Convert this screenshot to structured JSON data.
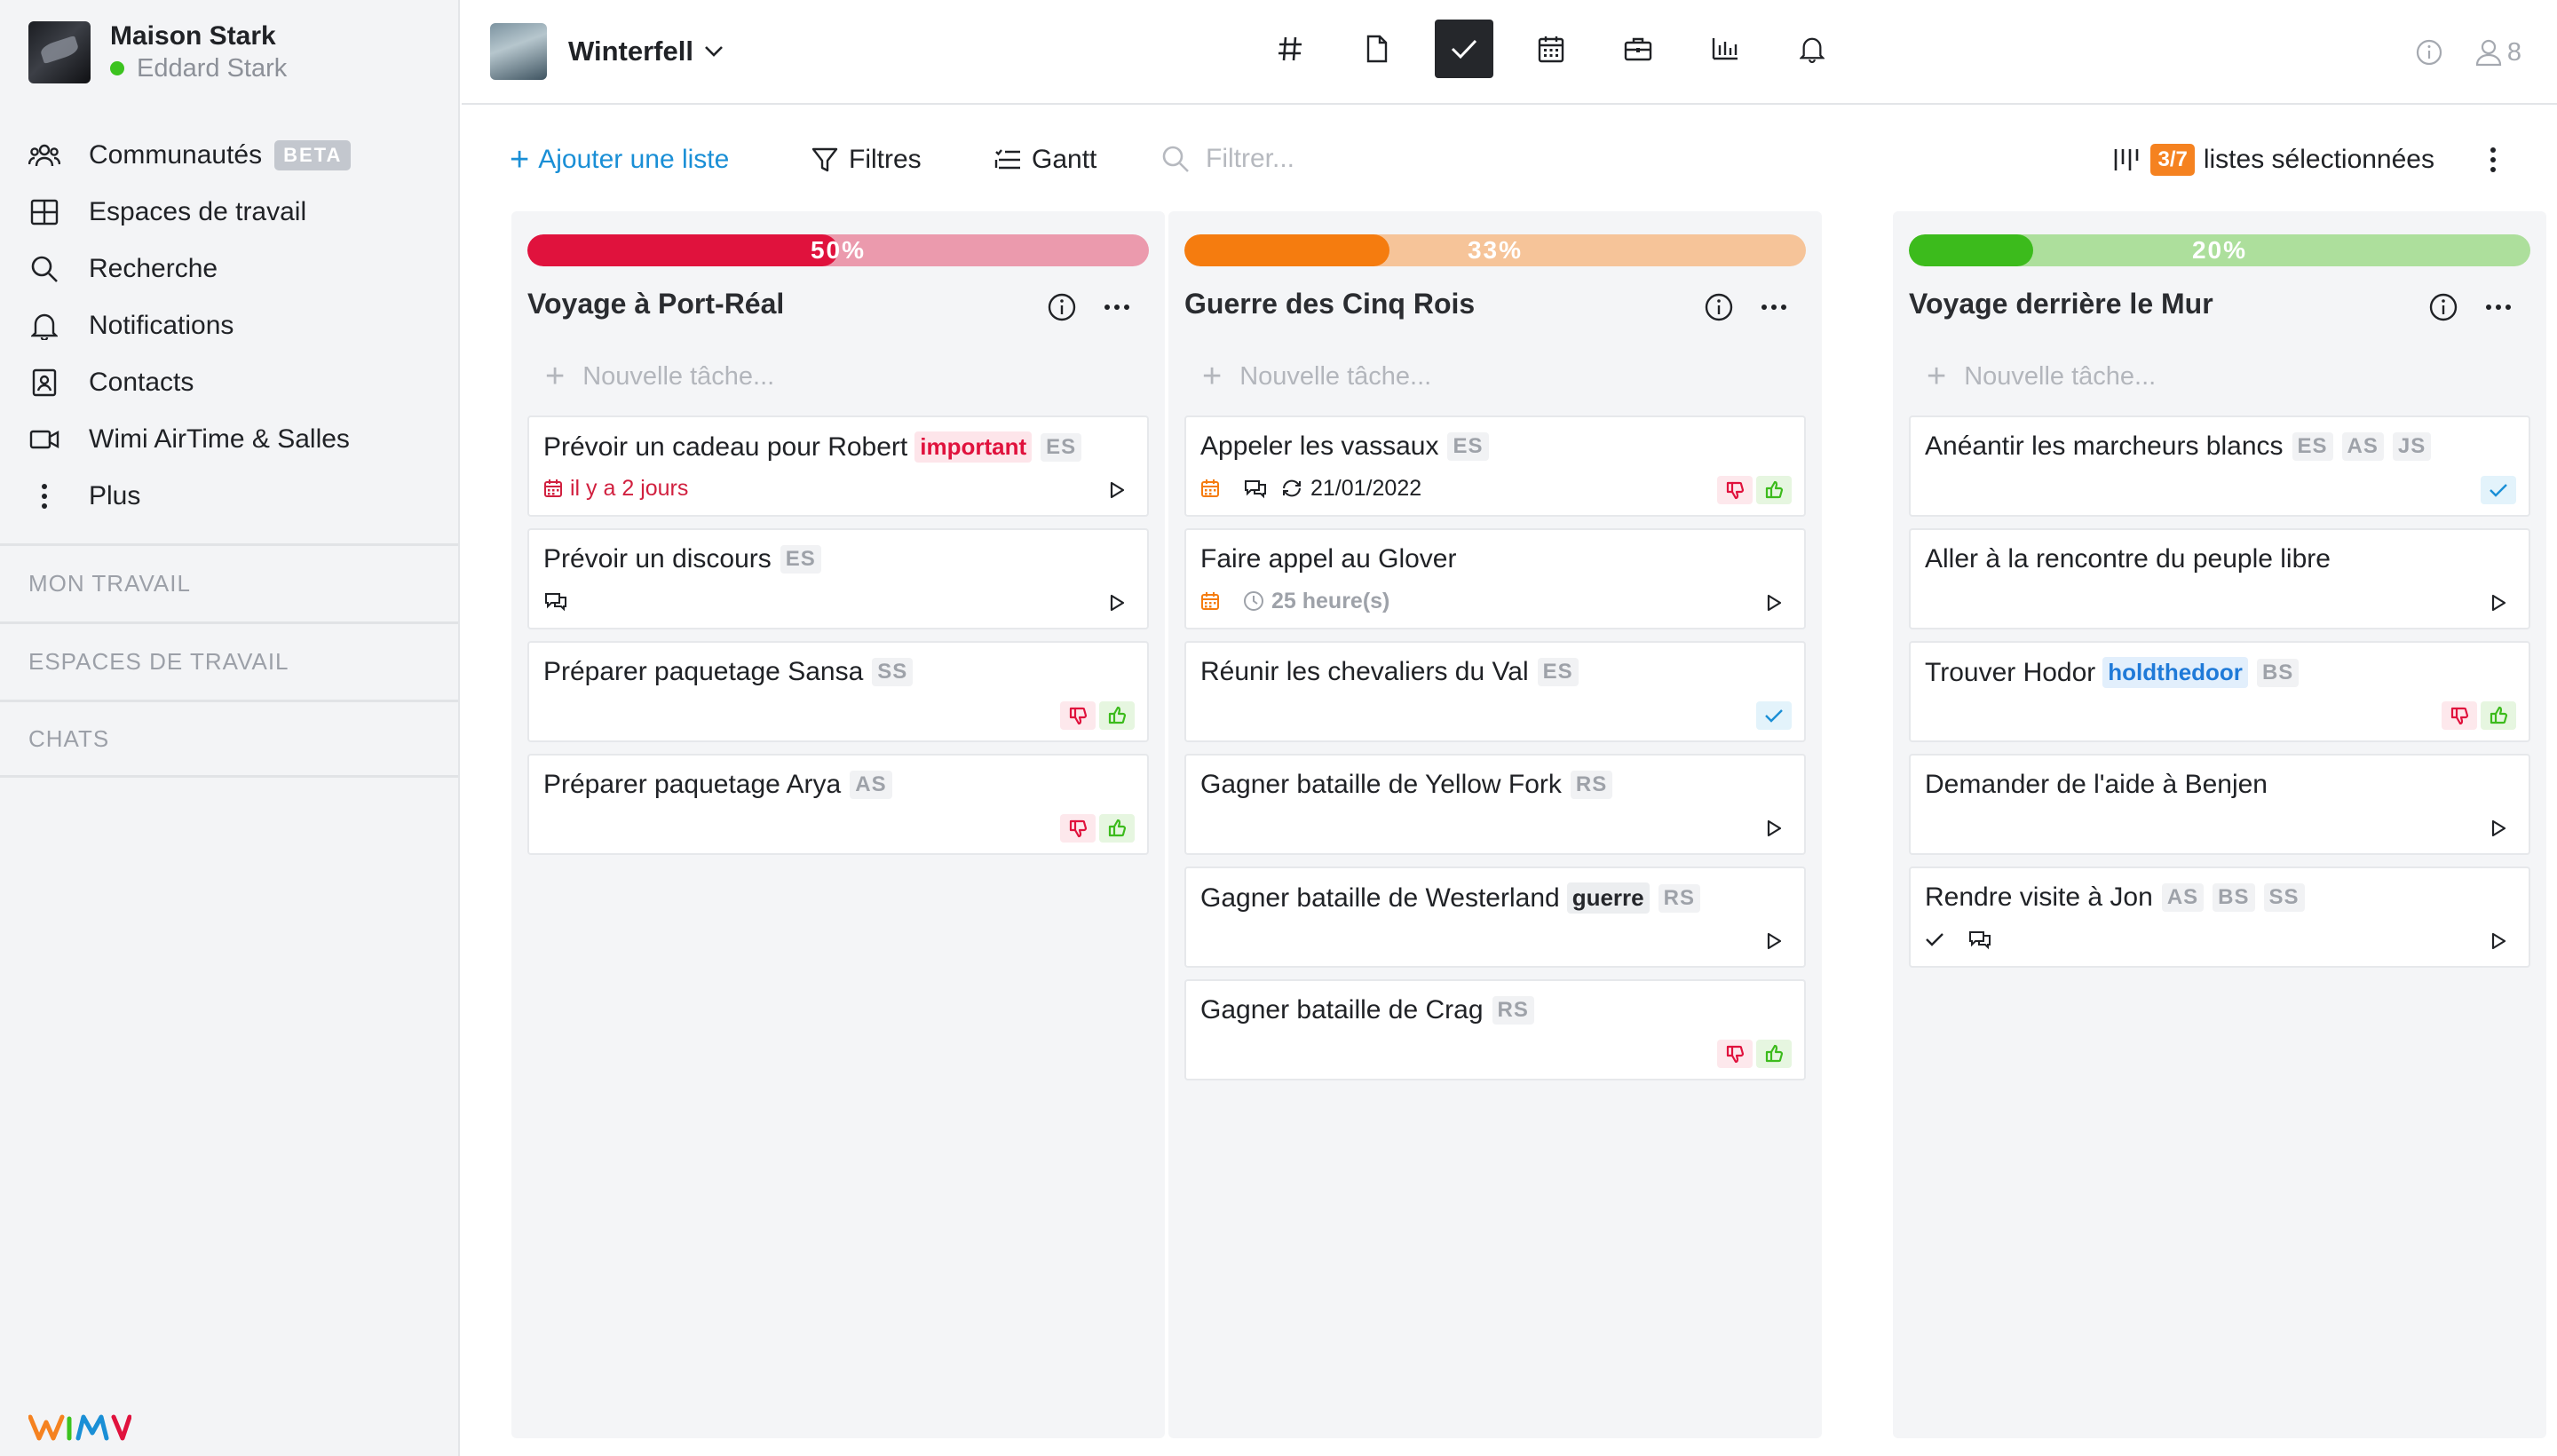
{
  "account": {
    "org": "Maison Stark",
    "user": "Eddard Stark"
  },
  "nav": {
    "items": [
      {
        "label": "Communautés",
        "badge": "BETA"
      },
      {
        "label": "Espaces de travail"
      },
      {
        "label": "Recherche"
      },
      {
        "label": "Notifications"
      },
      {
        "label": "Contacts"
      },
      {
        "label": "Wimi AirTime & Salles"
      },
      {
        "label": "Plus"
      }
    ]
  },
  "sections": [
    "MON TRAVAIL",
    "ESPACES DE TRAVAIL",
    "CHATS"
  ],
  "workspace": {
    "name": "Winterfell"
  },
  "topbar": {
    "member_count": "8"
  },
  "toolbar": {
    "add_list": "Ajouter une liste",
    "filters": "Filtres",
    "gantt": "Gantt",
    "search_placeholder": "Filtrer...",
    "selected_badge": "3/7",
    "selected_label": "listes sélectionnées"
  },
  "colors": {
    "accent": "#1a8fd6",
    "red": "#e0123d",
    "orange": "#f58220",
    "green": "#3cc31f"
  },
  "new_task_placeholder": "Nouvelle tâche...",
  "columns": [
    {
      "title": "Voyage à Port-Réal",
      "progress": 50,
      "progress_label": "50%",
      "color": "#e0123d",
      "track": "#eb9aad",
      "cards": [
        {
          "title": "Prévoir un cadeau pour Robert",
          "tag": "important",
          "tag_color": "red",
          "initials": [
            "ES"
          ],
          "date": "il y a 2 jours",
          "action": "play"
        },
        {
          "title": "Prévoir un discours",
          "initials": [
            "ES"
          ],
          "comment": true,
          "action": "play"
        },
        {
          "title": "Préparer paquetage Sansa",
          "initials": [
            "SS"
          ],
          "action": "vote"
        },
        {
          "title": "Préparer paquetage Arya",
          "initials": [
            "AS"
          ],
          "action": "vote"
        }
      ]
    },
    {
      "title": "Guerre des Cinq Rois",
      "progress": 33,
      "progress_label": "33%",
      "color": "#f57c0f",
      "track": "#f6c499",
      "cards": [
        {
          "title": "Appeler les vassaux",
          "initials": [
            "ES"
          ],
          "calendar": true,
          "comment": true,
          "recurrence": "21/01/2022",
          "action": "vote"
        },
        {
          "title": "Faire appel au Glover",
          "calendar": true,
          "duration": "25 heure(s)",
          "action": "play"
        },
        {
          "title": "Réunir les chevaliers du Val",
          "initials": [
            "ES"
          ],
          "action": "check"
        },
        {
          "title": "Gagner bataille de Yellow Fork",
          "initials": [
            "RS"
          ],
          "action": "play"
        },
        {
          "title": "Gagner bataille de Westerland",
          "tag": "guerre",
          "tag_color": "grey",
          "initials": [
            "RS"
          ],
          "action": "play"
        },
        {
          "title": "Gagner bataille de Crag",
          "initials": [
            "RS"
          ],
          "action": "vote"
        }
      ]
    },
    {
      "title": "Voyage derrière le Mur",
      "progress": 20,
      "progress_label": "20%",
      "color": "#3cbb1c",
      "track": "#addf9c",
      "cards": [
        {
          "title": "Anéantir les marcheurs blancs",
          "initials": [
            "ES",
            "AS",
            "JS"
          ],
          "action": "check"
        },
        {
          "title": "Aller à la rencontre du peuple libre",
          "action": "play"
        },
        {
          "title": "Trouver Hodor",
          "tag": "holdthedoor",
          "tag_color": "blue",
          "initials": [
            "BS"
          ],
          "action": "vote"
        },
        {
          "title": "Demander de l'aide à Benjen",
          "action": "play"
        },
        {
          "title": "Rendre visite à Jon",
          "initials": [
            "AS",
            "BS",
            "SS"
          ],
          "done_check": true,
          "comment": true,
          "action": "play"
        }
      ]
    }
  ]
}
